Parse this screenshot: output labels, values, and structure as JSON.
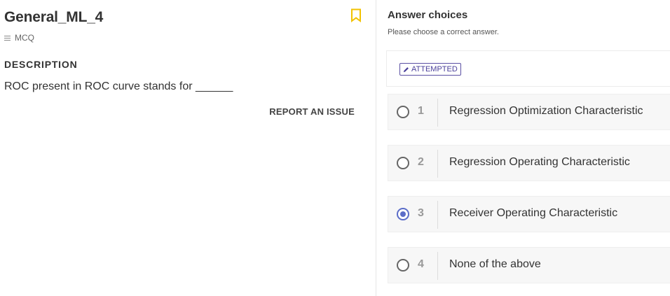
{
  "question": {
    "title": "General_ML_4",
    "type": "MCQ",
    "description_heading": "DESCRIPTION",
    "description": "ROC present in ROC curve stands for ______",
    "report_label": "REPORT AN ISSUE",
    "bookmark_icon": "bookmark-icon",
    "type_icon": "lines-icon"
  },
  "answers": {
    "heading": "Answer choices",
    "subheading": "Please choose a correct answer.",
    "status_badge": "ATTEMPTED",
    "status_icon": "pencil-icon",
    "selected_index": 3,
    "options": [
      {
        "number": "1",
        "label": "Regression Optimization Characteristic"
      },
      {
        "number": "2",
        "label": "Regression Operating Characteristic"
      },
      {
        "number": "3",
        "label": "Receiver Operating Characteristic"
      },
      {
        "number": "4",
        "label": "None of the above"
      }
    ]
  },
  "colors": {
    "accent": "#5b6dc8",
    "bookmark": "#f2c200",
    "badge": "#4a3f9a"
  }
}
